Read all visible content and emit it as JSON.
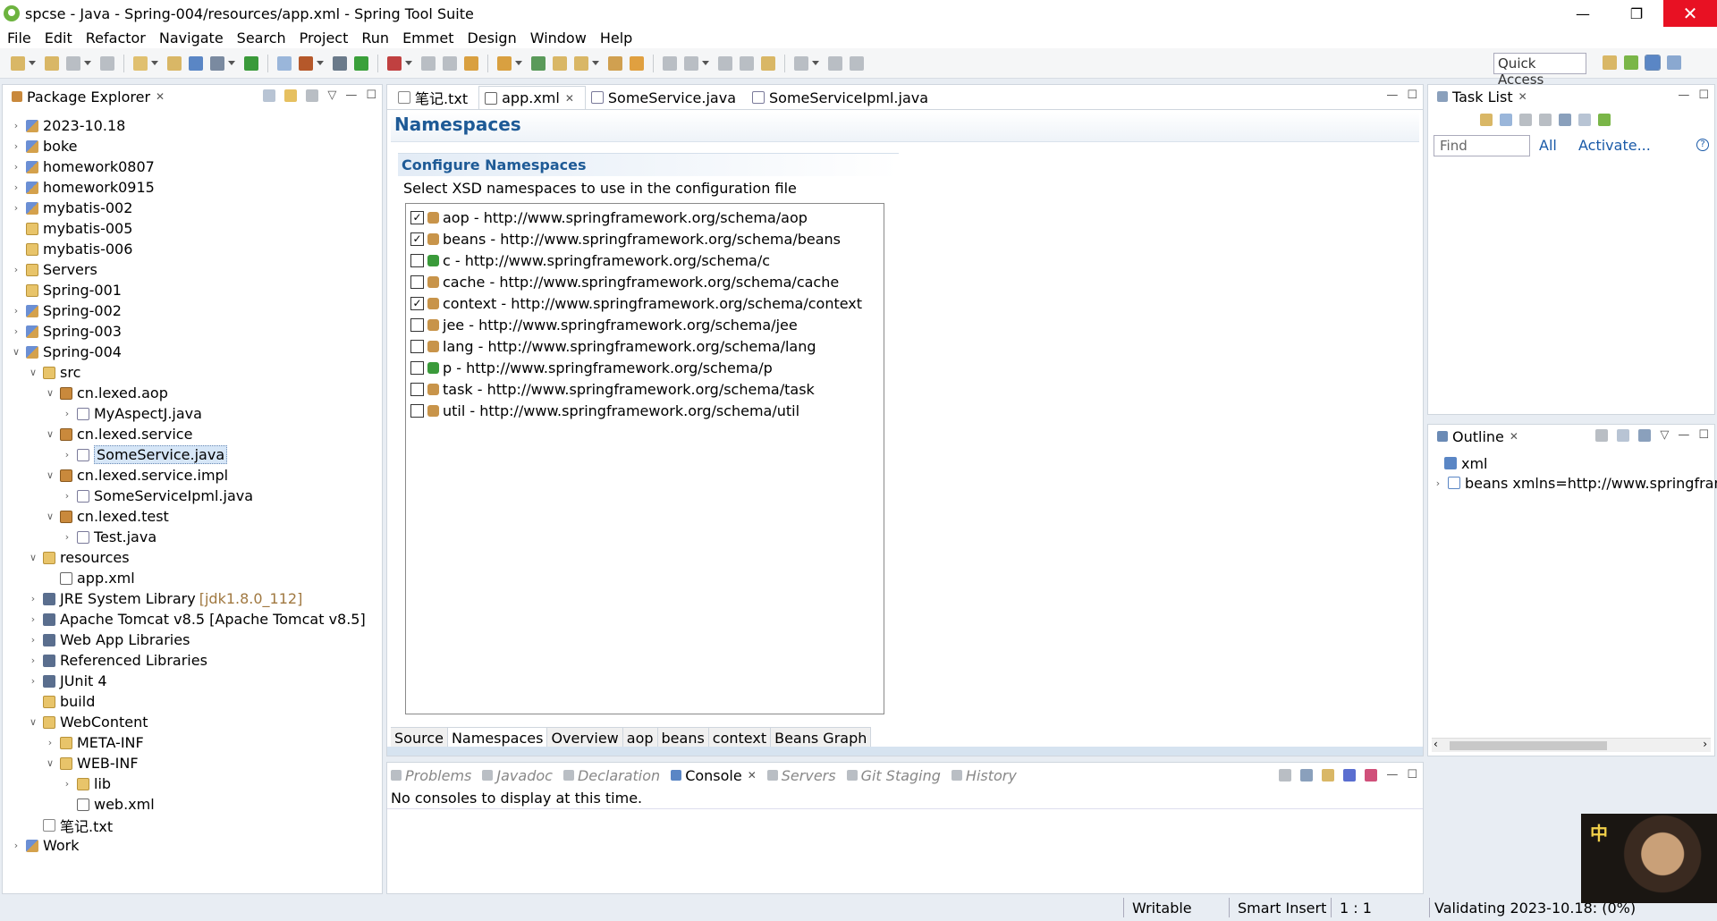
{
  "window": {
    "title": "spcse - Java - Spring-004/resources/app.xml - Spring Tool Suite",
    "minimize": "—",
    "restore": "❐",
    "close": "✕"
  },
  "menu": [
    "File",
    "Edit",
    "Refactor",
    "Navigate",
    "Search",
    "Project",
    "Run",
    "Emmet",
    "Design",
    "Window",
    "Help"
  ],
  "toolbar": {
    "quick_access": "Quick Access"
  },
  "package_explorer": {
    "title": "Package Explorer",
    "items": [
      {
        "label": "2023-10.18",
        "level": 0,
        "twisty": ">",
        "icon": "project"
      },
      {
        "label": "boke",
        "level": 0,
        "twisty": ">",
        "icon": "project"
      },
      {
        "label": "homework0807",
        "level": 0,
        "twisty": ">",
        "icon": "project"
      },
      {
        "label": "homework0915",
        "level": 0,
        "twisty": ">",
        "icon": "project"
      },
      {
        "label": "mybatis-002",
        "level": 0,
        "twisty": ">",
        "icon": "project"
      },
      {
        "label": "mybatis-005",
        "level": 0,
        "twisty": "",
        "icon": "folder"
      },
      {
        "label": "mybatis-006",
        "level": 0,
        "twisty": "",
        "icon": "folder"
      },
      {
        "label": "Servers",
        "level": 0,
        "twisty": ">",
        "icon": "folder"
      },
      {
        "label": "Spring-001",
        "level": 0,
        "twisty": "",
        "icon": "folder"
      },
      {
        "label": "Spring-002",
        "level": 0,
        "twisty": ">",
        "icon": "project"
      },
      {
        "label": "Spring-003",
        "level": 0,
        "twisty": ">",
        "icon": "project"
      },
      {
        "label": "Spring-004",
        "level": 0,
        "twisty": "v",
        "icon": "project"
      },
      {
        "label": "src",
        "level": 1,
        "twisty": "v",
        "icon": "src"
      },
      {
        "label": "cn.lexed.aop",
        "level": 2,
        "twisty": "v",
        "icon": "pkg"
      },
      {
        "label": "MyAspectJ.java",
        "level": 3,
        "twisty": ">",
        "icon": "java"
      },
      {
        "label": "cn.lexed.service",
        "level": 2,
        "twisty": "v",
        "icon": "pkg"
      },
      {
        "label": "SomeService.java",
        "level": 3,
        "twisty": ">",
        "icon": "java",
        "selected": true
      },
      {
        "label": "cn.lexed.service.impl",
        "level": 2,
        "twisty": "v",
        "icon": "pkg"
      },
      {
        "label": "SomeServiceIpml.java",
        "level": 3,
        "twisty": ">",
        "icon": "java"
      },
      {
        "label": "cn.lexed.test",
        "level": 2,
        "twisty": "v",
        "icon": "pkg"
      },
      {
        "label": "Test.java",
        "level": 3,
        "twisty": ">",
        "icon": "java"
      },
      {
        "label": "resources",
        "level": 1,
        "twisty": "v",
        "icon": "src"
      },
      {
        "label": "app.xml",
        "level": 2,
        "twisty": "",
        "icon": "xml"
      },
      {
        "label": "JRE System Library",
        "level": 1,
        "twisty": ">",
        "icon": "lib",
        "decoration": "[jdk1.8.0_112]"
      },
      {
        "label": "Apache Tomcat v8.5 [Apache Tomcat v8.5]",
        "level": 1,
        "twisty": ">",
        "icon": "lib"
      },
      {
        "label": "Web App Libraries",
        "level": 1,
        "twisty": ">",
        "icon": "lib"
      },
      {
        "label": "Referenced Libraries",
        "level": 1,
        "twisty": ">",
        "icon": "lib"
      },
      {
        "label": "JUnit 4",
        "level": 1,
        "twisty": ">",
        "icon": "lib"
      },
      {
        "label": "build",
        "level": 1,
        "twisty": "",
        "icon": "folder"
      },
      {
        "label": "WebContent",
        "level": 1,
        "twisty": "v",
        "icon": "folder"
      },
      {
        "label": "META-INF",
        "level": 2,
        "twisty": ">",
        "icon": "folder"
      },
      {
        "label": "WEB-INF",
        "level": 2,
        "twisty": "v",
        "icon": "folder"
      },
      {
        "label": "lib",
        "level": 3,
        "twisty": ">",
        "icon": "folder"
      },
      {
        "label": "web.xml",
        "level": 3,
        "twisty": "",
        "icon": "xml"
      },
      {
        "label": "笔记.txt",
        "level": 1,
        "twisty": "",
        "icon": "txt"
      },
      {
        "label": "Work",
        "level": 0,
        "twisty": ">",
        "icon": "project"
      }
    ]
  },
  "editor": {
    "tabs": [
      {
        "label": "笔记.txt",
        "active": false
      },
      {
        "label": "app.xml",
        "active": true
      },
      {
        "label": "SomeService.java",
        "active": false
      },
      {
        "label": "SomeServiceIpml.java",
        "active": false
      }
    ],
    "heading": "Namespaces",
    "section_title": "Configure Namespaces",
    "section_desc": "Select XSD namespaces to use in the configuration file",
    "namespaces": [
      {
        "label": "aop - http://www.springframework.org/schema/aop",
        "checked": true
      },
      {
        "label": "beans - http://www.springframework.org/schema/beans",
        "checked": true
      },
      {
        "label": "c - http://www.springframework.org/schema/c",
        "checked": false
      },
      {
        "label": "cache - http://www.springframework.org/schema/cache",
        "checked": false
      },
      {
        "label": "context - http://www.springframework.org/schema/context",
        "checked": true
      },
      {
        "label": "jee - http://www.springframework.org/schema/jee",
        "checked": false
      },
      {
        "label": "lang - http://www.springframework.org/schema/lang",
        "checked": false
      },
      {
        "label": "p - http://www.springframework.org/schema/p",
        "checked": false
      },
      {
        "label": "task - http://www.springframework.org/schema/task",
        "checked": false
      },
      {
        "label": "util - http://www.springframework.org/schema/util",
        "checked": false
      }
    ],
    "bottom_tabs": [
      {
        "label": "Source",
        "active": false
      },
      {
        "label": "Namespaces",
        "active": true
      },
      {
        "label": "Overview",
        "active": false
      },
      {
        "label": "aop",
        "active": false
      },
      {
        "label": "beans",
        "active": false
      },
      {
        "label": "context",
        "active": false
      },
      {
        "label": "Beans Graph",
        "active": false
      }
    ]
  },
  "console": {
    "tabs": [
      {
        "label": "Problems",
        "active": false
      },
      {
        "label": "Javadoc",
        "active": false
      },
      {
        "label": "Declaration",
        "active": false
      },
      {
        "label": "Console",
        "active": true
      },
      {
        "label": "Servers",
        "active": false
      },
      {
        "label": "Git Staging",
        "active": false
      },
      {
        "label": "History",
        "active": false
      }
    ],
    "message": "No consoles to display at this time."
  },
  "task_list": {
    "title": "Task List",
    "find_placeholder": "Find",
    "all_label": "All",
    "activate_label": "Activate..."
  },
  "outline": {
    "title": "Outline",
    "items": [
      {
        "label": "xml",
        "twisty": ""
      },
      {
        "label": "beans xmlns=http://www.springframe",
        "twisty": ">"
      }
    ]
  },
  "statusbar": {
    "writable": "Writable",
    "insert_mode": "Smart Insert",
    "position": "1 : 1",
    "progress": "Validating 2023-10.18: (0%)"
  },
  "overlay": {
    "ime_char": "中"
  },
  "colors": {
    "accent": "#1e5a96",
    "close": "#e81123",
    "selection": "#d6e6f7"
  }
}
